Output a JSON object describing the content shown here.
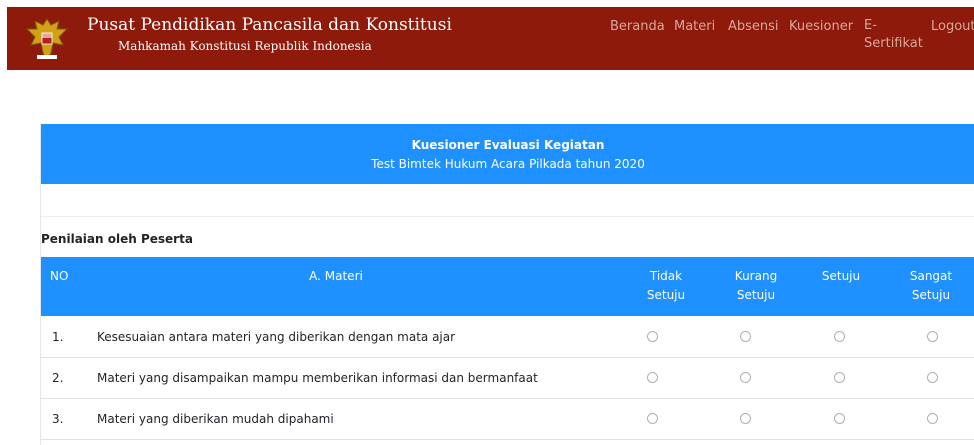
{
  "header": {
    "title": "Pusat Pendidikan Pancasila dan Konstitusi",
    "subtitle": "Mahkamah Konstitusi Republik Indonesia",
    "bg_color": "#8d1a0b",
    "nav": [
      {
        "label": "Beranda"
      },
      {
        "label": "Materi"
      },
      {
        "label": "Absensi"
      },
      {
        "label": "Kuesioner"
      },
      {
        "label": "E-Sertifikat"
      },
      {
        "label": "Logout"
      }
    ]
  },
  "card": {
    "title": "Kuesioner Evaluasi Kegiatan",
    "subtitle": "Test Bimtek Hukum Acara Pilkada tahun 2020",
    "accent_color": "#1e90ff"
  },
  "section": {
    "title": "Penilaian oleh Peserta"
  },
  "table": {
    "col_no": "NO",
    "col_materi": "A. Materi",
    "options": [
      "Tidak Setuju",
      "Kurang Setuju",
      "Setuju",
      "Sangat Setuju"
    ],
    "rows": [
      {
        "no": "1.",
        "text": "Kesesuaian antara materi yang diberikan dengan mata ajar"
      },
      {
        "no": "2.",
        "text": "Materi yang disampaikan mampu memberikan informasi dan bermanfaat"
      },
      {
        "no": "3.",
        "text": "Materi yang diberikan mudah dipahami"
      }
    ]
  }
}
